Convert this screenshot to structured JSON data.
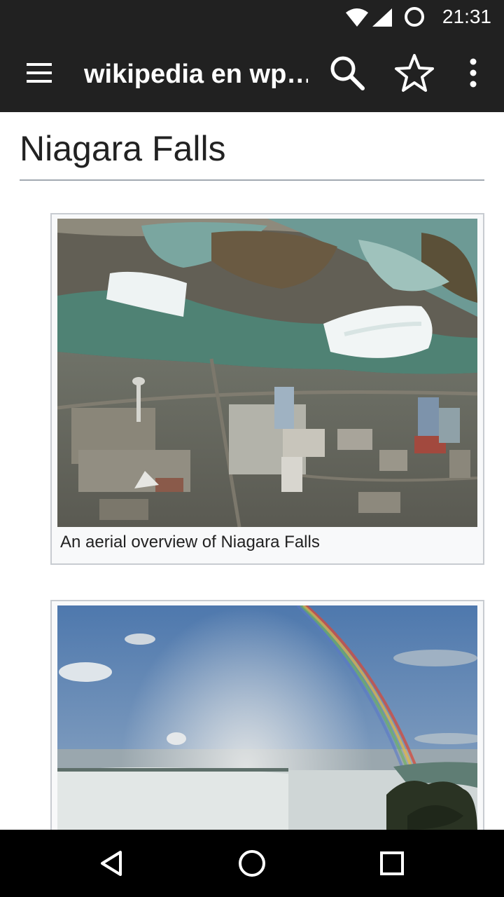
{
  "status_bar": {
    "time": "21:31",
    "icons": [
      "wifi-icon",
      "cell-signal-icon",
      "sync-icon"
    ]
  },
  "toolbar": {
    "title": "wikipedia en wp…",
    "icons": [
      "menu-icon",
      "search-icon",
      "star-icon",
      "more-vertical-icon"
    ]
  },
  "article": {
    "title": "Niagara Falls",
    "figures": [
      {
        "caption": "An aerial overview of Niagara Falls",
        "image": "aerial-niagara-falls-photo"
      },
      {
        "caption": "",
        "image": "horseshoe-falls-rainbow-photo"
      }
    ]
  },
  "nav_bar": {
    "icons": [
      "back-icon",
      "home-icon",
      "recents-icon"
    ]
  },
  "colors": {
    "toolbar_bg": "#212121",
    "nav_bg": "#000000",
    "rule": "#a2a9b1",
    "figure_border": "#c8ccd1",
    "figure_bg": "#f8f9fa"
  }
}
